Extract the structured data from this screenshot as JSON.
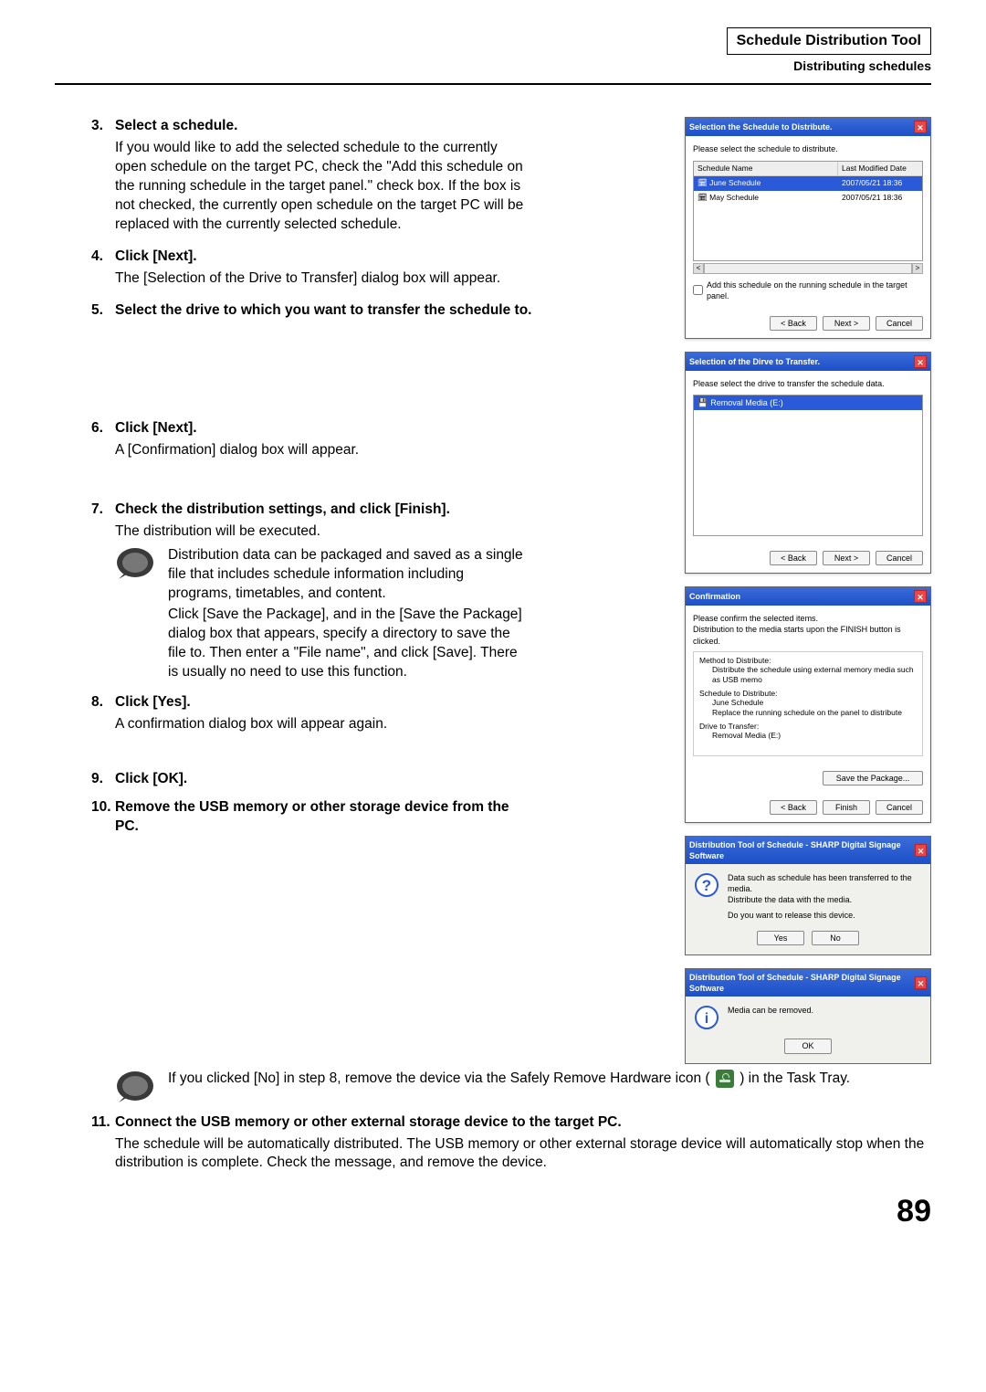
{
  "header": {
    "title": "Schedule Distribution Tool",
    "subtitle": "Distributing schedules"
  },
  "steps": {
    "s3": {
      "num": "3.",
      "title": "Select a schedule.",
      "body": "If you would like to add the selected schedule to the currently open schedule on the target PC, check the \"Add this schedule on the running schedule in the target panel.\" check box. If the box is not checked, the currently open schedule on the target PC will be replaced with the currently selected schedule."
    },
    "s4": {
      "num": "4.",
      "title": "Click [Next].",
      "body": "The [Selection of the Drive to Transfer] dialog box will appear."
    },
    "s5": {
      "num": "5.",
      "title": "Select the drive to which you want to transfer the schedule to."
    },
    "s6": {
      "num": "6.",
      "title": "Click [Next].",
      "body": "A [Confirmation] dialog box will appear."
    },
    "s7": {
      "num": "7.",
      "title": "Check the distribution settings, and click [Finish].",
      "body": "The distribution will be executed.",
      "note1": "Distribution data can be packaged and saved as a single file that includes schedule information including programs, timetables, and content.",
      "note2": "Click [Save the Package], and in the [Save the Package] dialog box that appears, specify a directory to save the file to. Then enter a \"File name\", and click [Save]. There is usually no need to use this function."
    },
    "s8": {
      "num": "8.",
      "title": "Click [Yes].",
      "body": "A confirmation dialog box will appear again."
    },
    "s9": {
      "num": "9.",
      "title": "Click [OK]."
    },
    "s10": {
      "num": "10.",
      "title": "Remove the USB memory or other storage device from the PC.",
      "note_a": "If you clicked [No] in step 8, remove the device via the Safely Remove Hardware icon (",
      "note_b": ") in the Task Tray."
    },
    "s11": {
      "num": "11.",
      "title": "Connect the USB memory or other external storage device to the target PC.",
      "body": "The schedule will be automatically distributed. The USB memory or other external storage device will automatically stop when the distribution is complete. Check the message, and remove the device."
    }
  },
  "dialogs": {
    "selectSchedule": {
      "title": "Selection the Schedule to Distribute.",
      "instr": "Please select the schedule to distribute.",
      "colName": "Schedule Name",
      "colDate": "Last Modified Date",
      "row1name": "June Schedule",
      "row1date": "2007/05/21 18:36",
      "row2name": "May Schedule",
      "row2date": "2007/05/21 18:36",
      "checkbox": "Add this schedule on the running schedule in the target panel.",
      "back": "< Back",
      "next": "Next >",
      "cancel": "Cancel"
    },
    "selectDrive": {
      "title": "Selection of the Dirve to Transfer.",
      "instr": "Please select the drive to transfer the schedule data.",
      "drive": "Removal Media (E:)",
      "back": "< Back",
      "next": "Next >",
      "cancel": "Cancel"
    },
    "confirm": {
      "title": "Confirmation",
      "line1": "Please confirm the selected items.",
      "line2": "Distribution to the media starts upon the FINISH button is clicked.",
      "m_title": "Method to Distribute:",
      "m_text": "Distribute the schedule using external memory media such as USB memo",
      "s_title": "Schedule to Distribute:",
      "s_text1": "June Schedule",
      "s_text2": "Replace the running schedule on the panel to distribute",
      "d_title": "Drive to Transfer:",
      "d_text": "Removal Media (E:)",
      "savepkg": "Save the Package...",
      "back": "< Back",
      "finish": "Finish",
      "cancel": "Cancel"
    },
    "yesno": {
      "title": "Distribution Tool of Schedule - SHARP Digital Signage Software",
      "line1": "Data such as schedule has been transferred to the media.",
      "line2": "Distribute the data with the media.",
      "line3": "Do you want to release this device.",
      "yes": "Yes",
      "no": "No"
    },
    "ok": {
      "title": "Distribution Tool of Schedule - SHARP Digital Signage Software",
      "text": "Media can be removed.",
      "ok": "OK"
    }
  },
  "pagenum": "89"
}
